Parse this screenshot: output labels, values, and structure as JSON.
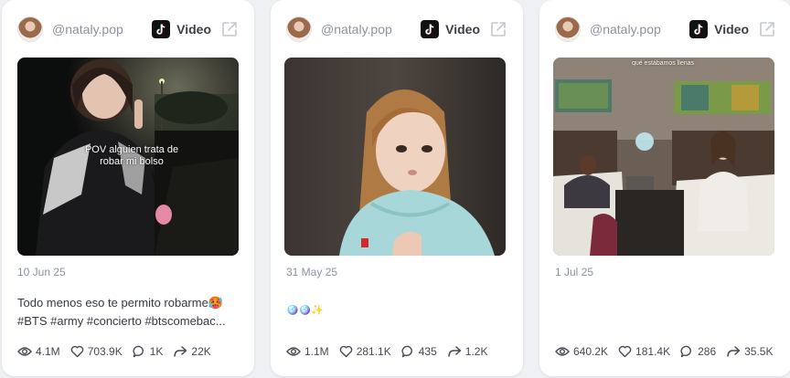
{
  "cards": [
    {
      "handle": "@nataly.pop",
      "platform_label": "Video",
      "platform_icon": "tiktok-icon",
      "thumbnail_overlay": "POV alguien trata de robar mi bolso",
      "date": "10 Jun 25",
      "caption_line1": "Todo menos eso te permito robarme🥵",
      "caption_line2": "#BTS #army #concierto #btscomebac...",
      "views": "4.1M",
      "likes": "703.9K",
      "comments": "1K",
      "shares": "22K"
    },
    {
      "handle": "@nataly.pop",
      "platform_label": "Video",
      "platform_icon": "tiktok-icon",
      "date": "31 May 25",
      "caption_line1": "🪩🪩✨",
      "views": "1.1M",
      "likes": "281.1K",
      "comments": "435",
      "shares": "1.2K"
    },
    {
      "handle": "@nataly.pop",
      "platform_label": "Video",
      "platform_icon": "tiktok-icon",
      "thumbnail_overlay": "qué estábamos llenas",
      "date": "1 Jul 25",
      "views": "640.2K",
      "likes": "181.4K",
      "comments": "286",
      "shares": "35.5K"
    }
  ],
  "colors": {
    "page_bg": "#eef0f4",
    "card_bg": "#ffffff",
    "muted_text": "#8b93a1",
    "body_text": "#353a45"
  }
}
